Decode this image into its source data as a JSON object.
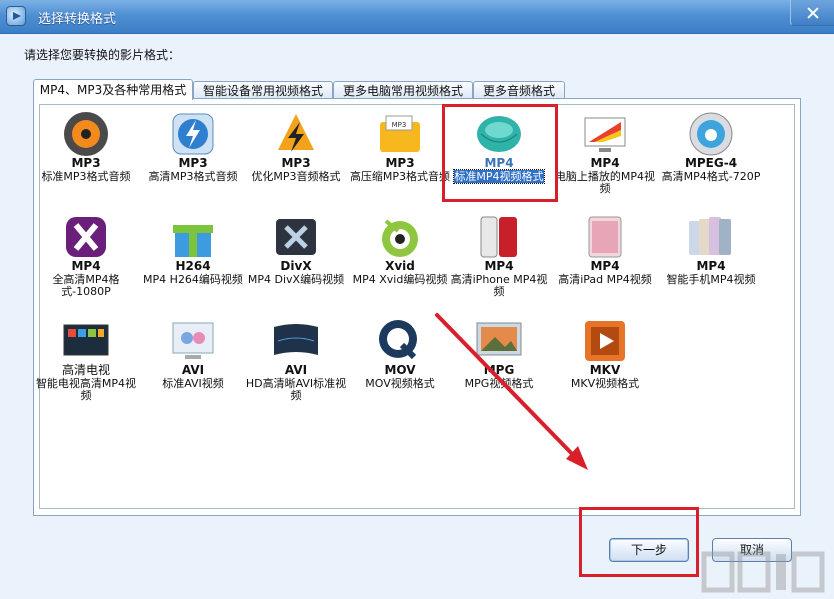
{
  "window": {
    "title": "选择转换格式",
    "close_icon": "close-icon",
    "app_icon": "app-logo-icon"
  },
  "prompt": "请选择您要转换的影片格式：",
  "tabs": [
    {
      "label": "MP4、MP3及各种常用格式",
      "active": true
    },
    {
      "label": "智能设备常用视频格式",
      "active": false
    },
    {
      "label": "更多电脑常用视频格式",
      "active": false
    },
    {
      "label": "更多音频格式",
      "active": false
    }
  ],
  "formats": [
    {
      "name": "MP3",
      "desc": "标准MP3格式音频",
      "icon": "speaker-disc-icon",
      "selected": false
    },
    {
      "name": "MP3",
      "desc": "高清MP3格式音频",
      "icon": "lightning-disc-icon",
      "selected": false
    },
    {
      "name": "MP3",
      "desc": "优化MP3音频格式",
      "icon": "cone-lightning-icon",
      "selected": false
    },
    {
      "name": "MP3",
      "desc": "高压缩MP3格式音频",
      "icon": "folder-mp3-icon",
      "selected": false
    },
    {
      "name": "MP4",
      "desc": "标准MP4视频格式",
      "icon": "sphere-icon",
      "selected": true
    },
    {
      "name": "MP4",
      "desc": "电脑上播放的MP4视频",
      "icon": "monitor-rainbow-icon",
      "selected": false
    },
    {
      "name": "MPEG-4",
      "desc": "高清MP4格式-720P",
      "icon": "apple-circle-icon",
      "selected": false
    },
    {
      "name": "MP4",
      "desc": "全高清MP4格式-1080P",
      "icon": "x-purple-icon",
      "selected": false
    },
    {
      "name": "H264",
      "desc": "MP4 H264编码视频",
      "icon": "gift-box-icon",
      "selected": false
    },
    {
      "name": "DivX",
      "desc": "MP4 DivX编码视频",
      "icon": "divx-x-icon",
      "selected": false
    },
    {
      "name": "Xvid",
      "desc": "MP4 Xvid编码视频",
      "icon": "xvid-eye-icon",
      "selected": false
    },
    {
      "name": "MP4",
      "desc": "高清iPhone MP4视频",
      "icon": "iphone-icon",
      "selected": false
    },
    {
      "name": "MP4",
      "desc": "高清iPad MP4视频",
      "icon": "ipad-icon",
      "selected": false
    },
    {
      "name": "MP4",
      "desc": "智能手机MP4视频",
      "icon": "smartphones-icon",
      "selected": false
    },
    {
      "name": "高清电视",
      "desc": "智能电视高清MP4视频",
      "icon": "tv-icon",
      "selected": false
    },
    {
      "name": "AVI",
      "desc": "标准AVI视频",
      "icon": "monitor-avi-icon",
      "selected": false
    },
    {
      "name": "AVI",
      "desc": "HD高清晰AVI标准视频",
      "icon": "curved-screen-icon",
      "selected": false
    },
    {
      "name": "MOV",
      "desc": "MOV视频格式",
      "icon": "quicktime-icon",
      "selected": false
    },
    {
      "name": "MPG",
      "desc": "MPG视频格式",
      "icon": "landscape-screen-icon",
      "selected": false
    },
    {
      "name": "MKV",
      "desc": "MKV视频格式",
      "icon": "play-square-icon",
      "selected": false
    }
  ],
  "buttons": {
    "next": "下一步",
    "cancel": "取消"
  },
  "colors": {
    "titlebar": "#4f8fd3",
    "highlight": "#d9202a",
    "selection": "#3170c7"
  }
}
